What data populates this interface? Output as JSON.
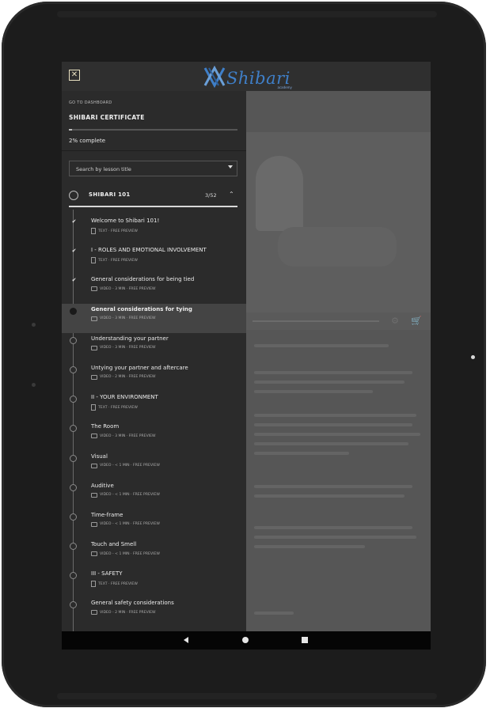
{
  "header": {
    "logo_text": "Shibari",
    "logo_subtext": "academy",
    "close_glyph": "✕"
  },
  "sidebar": {
    "go_to_dashboard": "GO TO DASHBOARD",
    "course_title": "SHIBARI CERTIFICATE",
    "progress_fraction": 0.02,
    "percent_complete": "2% complete",
    "search_placeholder": "Search by lesson title",
    "section": {
      "title": "SHIBARI 101",
      "count": "3/52",
      "chevron": "⌃"
    },
    "lessons": [
      {
        "title": "Welcome to Shibari 101!",
        "meta": "TEXT · FREE PREVIEW",
        "kind": "text",
        "status": "done"
      },
      {
        "title": "I - ROLES AND EMOTIONAL INVOLVEMENT",
        "meta": "TEXT · FREE PREVIEW",
        "kind": "text",
        "status": "done"
      },
      {
        "title": "General considerations for being tied",
        "meta": "VIDEO - 3 MIN · FREE PREVIEW",
        "kind": "video",
        "status": "done"
      },
      {
        "title": "General considerations for tying",
        "meta": "VIDEO - 3 MIN · FREE PREVIEW",
        "kind": "video",
        "status": "current"
      },
      {
        "title": "Understanding your partner",
        "meta": "VIDEO - 3 MIN · FREE PREVIEW",
        "kind": "video",
        "status": "todo"
      },
      {
        "title": "Untying your partner and aftercare",
        "meta": "VIDEO - 2 MIN · FREE PREVIEW",
        "kind": "video",
        "status": "todo"
      },
      {
        "title": "II - YOUR ENVIRONMENT",
        "meta": "TEXT · FREE PREVIEW",
        "kind": "text",
        "status": "todo"
      },
      {
        "title": "The Room",
        "meta": "VIDEO - 3 MIN · FREE PREVIEW",
        "kind": "video",
        "status": "todo"
      },
      {
        "title": "Visual",
        "meta": "VIDEO - < 1 MIN · FREE PREVIEW",
        "kind": "video",
        "status": "todo"
      },
      {
        "title": "Auditive",
        "meta": "VIDEO - < 1 MIN · FREE PREVIEW",
        "kind": "video",
        "status": "todo"
      },
      {
        "title": "Time-frame",
        "meta": "VIDEO - < 1 MIN · FREE PREVIEW",
        "kind": "video",
        "status": "todo"
      },
      {
        "title": "Touch and Smell",
        "meta": "VIDEO - < 1 MIN · FREE PREVIEW",
        "kind": "video",
        "status": "todo"
      },
      {
        "title": "III - SAFETY",
        "meta": "TEXT · FREE PREVIEW",
        "kind": "text",
        "status": "todo"
      },
      {
        "title": "General safety considerations",
        "meta": "VIDEO - 2 MIN · FREE PREVIEW",
        "kind": "video",
        "status": "todo"
      }
    ]
  },
  "icons": {
    "done": "✔",
    "settings": "⚙",
    "cart": "🛒"
  },
  "colors": {
    "brand_blue": "#3f7fc8",
    "sidebar_bg": "#2b2b2b",
    "active_row": "#444444"
  }
}
